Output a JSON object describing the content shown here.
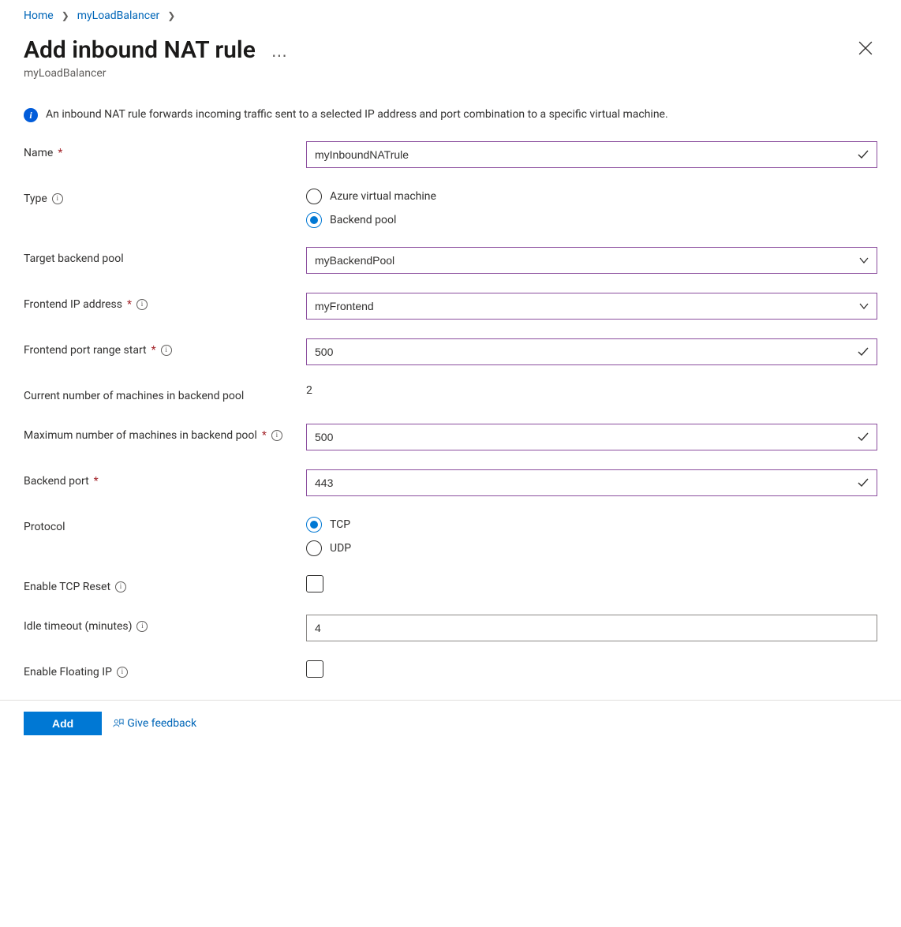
{
  "breadcrumb": {
    "home": "Home",
    "resource": "myLoadBalancer"
  },
  "header": {
    "title": "Add inbound NAT rule",
    "subtitle": "myLoadBalancer"
  },
  "info": "An inbound NAT rule forwards incoming traffic sent to a selected IP address and port combination to a specific virtual machine.",
  "labels": {
    "name": "Name",
    "type": "Type",
    "target_backend_pool": "Target backend pool",
    "frontend_ip": "Frontend IP address",
    "frontend_port_start": "Frontend port range start",
    "current_machines": "Current number of machines in backend pool",
    "max_machines": "Maximum number of machines in backend pool",
    "backend_port": "Backend port",
    "protocol": "Protocol",
    "enable_tcp_reset": "Enable TCP Reset",
    "idle_timeout": "Idle timeout (minutes)",
    "enable_floating_ip": "Enable Floating IP"
  },
  "values": {
    "name": "myInboundNATrule",
    "target_backend_pool": "myBackendPool",
    "frontend_ip": "myFrontend",
    "frontend_port_start": "500",
    "current_machines": "2",
    "max_machines": "500",
    "backend_port": "443",
    "idle_timeout": "4"
  },
  "type_options": {
    "vm": "Azure virtual machine",
    "pool": "Backend pool",
    "selected": "pool"
  },
  "protocol_options": {
    "tcp": "TCP",
    "udp": "UDP",
    "selected": "tcp"
  },
  "checkboxes": {
    "tcp_reset": false,
    "floating_ip": false
  },
  "footer": {
    "add": "Add",
    "feedback": "Give feedback"
  }
}
